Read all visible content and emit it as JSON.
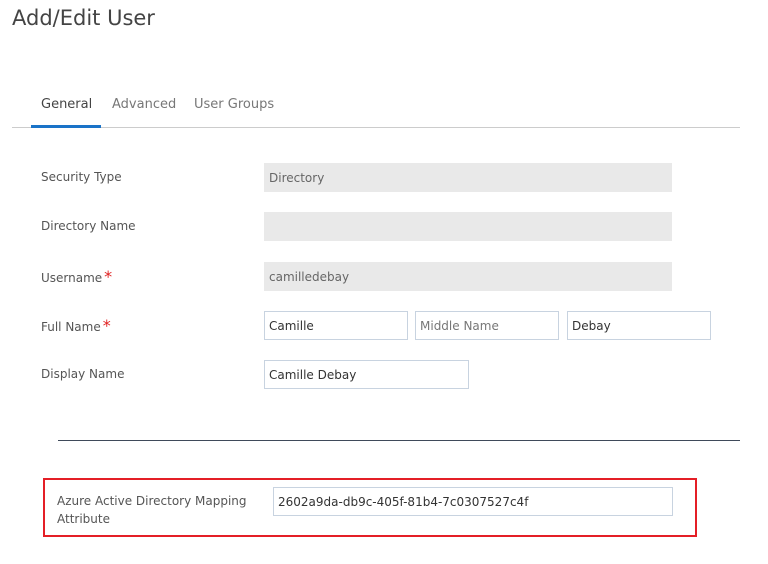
{
  "page_title": "Add/Edit User",
  "tabs": [
    {
      "label": "General"
    },
    {
      "label": "Advanced"
    },
    {
      "label": "User Groups"
    }
  ],
  "form": {
    "security_type": {
      "label": "Security Type",
      "value": "Directory"
    },
    "directory_name": {
      "label": "Directory Name",
      "value": ""
    },
    "username": {
      "label": "Username",
      "value": "camilledebay",
      "required": "*"
    },
    "full_name": {
      "label": "Full Name",
      "required": "*",
      "first": "Camille",
      "middle_placeholder": "Middle Name",
      "last": "Debay"
    },
    "display_name": {
      "label": "Display Name",
      "value": "Camille Debay"
    },
    "azure_mapping": {
      "label": "Azure Active Directory Mapping Attribute",
      "value": "2602a9da-db9c-405f-81b4-7c0307527c4f"
    }
  },
  "colors": {
    "accent": "#1a73c8",
    "highlight": "#e41f26",
    "required": "#e02020"
  }
}
